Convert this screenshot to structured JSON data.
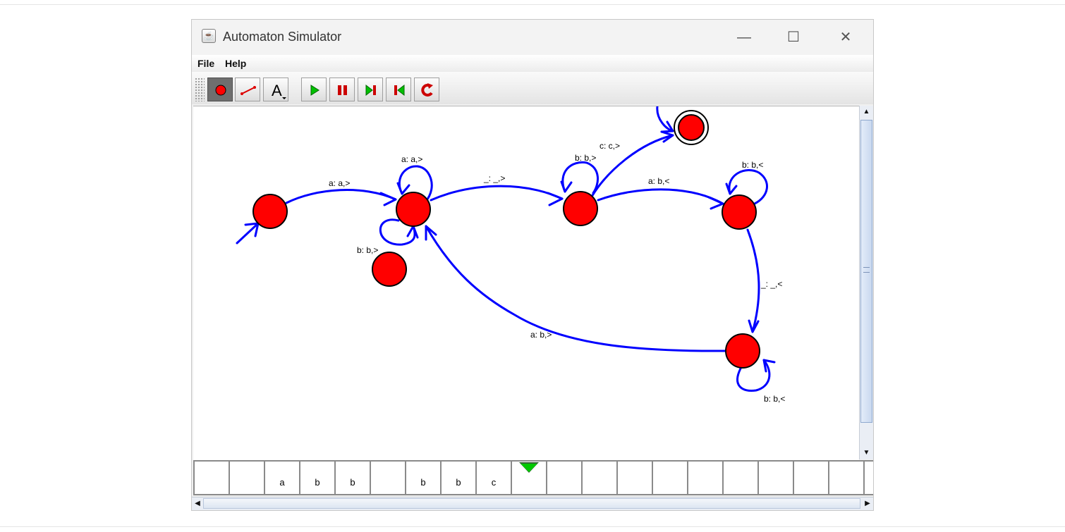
{
  "window": {
    "title": "Automaton Simulator",
    "icon": "java-cup-icon",
    "controls": {
      "minimize": "—",
      "maximize": "☐",
      "close": "✕"
    }
  },
  "menu": {
    "items": [
      "File",
      "Help"
    ]
  },
  "toolbar": {
    "buttons": [
      {
        "name": "add-state-tool",
        "icon": "red-circle-icon",
        "selected": true
      },
      {
        "name": "add-transition-tool",
        "icon": "transition-line-icon",
        "selected": false
      },
      {
        "name": "text-tool",
        "icon": "text-a-icon",
        "label": "A",
        "selected": false
      },
      {
        "name": "play-button",
        "icon": "play-icon",
        "color": "#00c000"
      },
      {
        "name": "pause-button",
        "icon": "pause-icon",
        "color": "#cc0000"
      },
      {
        "name": "step-forward-button",
        "icon": "step-forward-icon"
      },
      {
        "name": "step-back-button",
        "icon": "step-back-icon"
      },
      {
        "name": "reset-button",
        "icon": "reset-icon"
      }
    ]
  },
  "colors": {
    "state_fill": "#ff0000",
    "edge": "#0000ff",
    "head": "#00c800"
  },
  "automaton": {
    "transition_labels": [
      "a: a,>",
      "a: a,>",
      "b: b,>",
      "_: _,>",
      "b: b,>",
      "c: c,>",
      "a: b,<",
      "b: b,<",
      "_: _,<",
      "a: b,>",
      "b: b,<"
    ]
  },
  "tape": {
    "cells": [
      "",
      "",
      "a",
      "b",
      "b",
      "",
      "b",
      "b",
      "c",
      "",
      "",
      "",
      "",
      "",
      "",
      "",
      "",
      "",
      "",
      ""
    ],
    "head_index": 9
  }
}
